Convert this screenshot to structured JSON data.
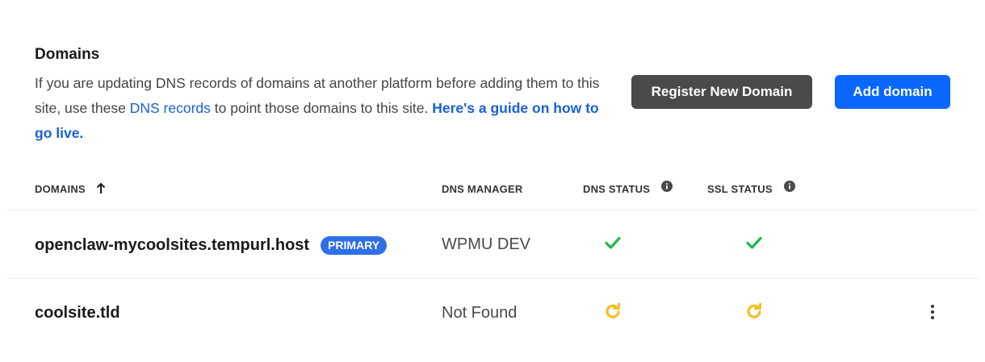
{
  "header": {
    "title": "Domains",
    "desc_part1": "If you are updating DNS records of domains at another platform before adding them to this site, use these ",
    "dns_link": "DNS records",
    "desc_part2": " to point those domains to this site. ",
    "guide_link": "Here's a guide on how to go live."
  },
  "actions": {
    "register_label": "Register New Domain",
    "add_label": "Add domain"
  },
  "table": {
    "columns": {
      "domains": "DOMAINS",
      "dns_manager": "DNS MANAGER",
      "dns_status": "DNS STATUS",
      "ssl_status": "SSL STATUS"
    },
    "rows": [
      {
        "domain": "openclaw-mycoolsites.tempurl.host",
        "badge": "PRIMARY",
        "dns_manager": "WPMU DEV",
        "dns_status": "check-icon",
        "ssl_status": "check-icon"
      },
      {
        "domain": "coolsite.tld",
        "badge": "",
        "dns_manager": "Not Found",
        "dns_status": "refresh-icon",
        "ssl_status": "refresh-icon"
      }
    ]
  },
  "colors": {
    "accent_blue": "#0a67ff",
    "link_blue": "#1a5fd6",
    "badge_blue": "#2f6fe6",
    "register_gray": "#4a4a4a",
    "success_green": "#1fb84a",
    "pending_yellow": "#f2c01e"
  }
}
